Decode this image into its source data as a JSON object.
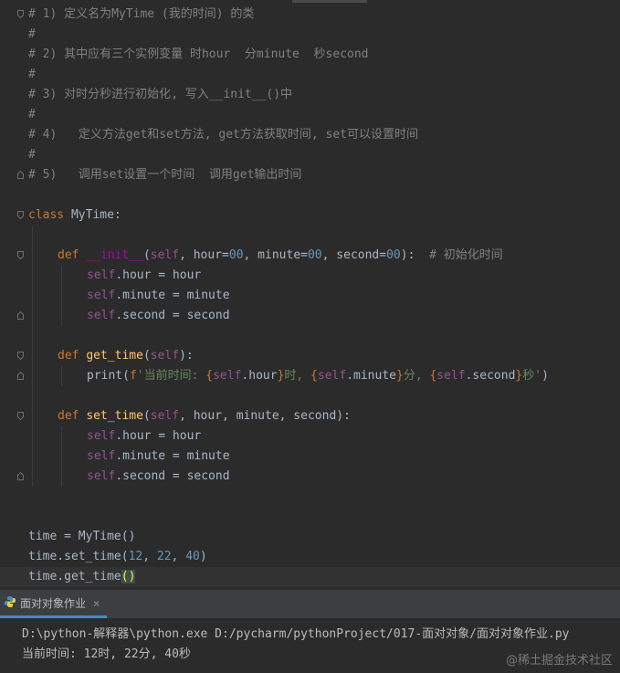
{
  "editor": {
    "lines": [
      {
        "indent": 0,
        "fold": "start",
        "tokens": [
          [
            "c-comment",
            "# 1) 定义名为MyTime (我的时间) 的类"
          ]
        ]
      },
      {
        "indent": 0,
        "tokens": [
          [
            "c-comment",
            "#"
          ]
        ]
      },
      {
        "indent": 0,
        "tokens": [
          [
            "c-comment",
            "# 2) 其中应有三个实例变量 时hour  分minute  秒second"
          ]
        ]
      },
      {
        "indent": 0,
        "tokens": [
          [
            "c-comment",
            "#"
          ]
        ]
      },
      {
        "indent": 0,
        "tokens": [
          [
            "c-comment",
            "# 3) 对时分秒进行初始化, 写入__init__()中"
          ]
        ]
      },
      {
        "indent": 0,
        "tokens": [
          [
            "c-comment",
            "#"
          ]
        ]
      },
      {
        "indent": 0,
        "tokens": [
          [
            "c-comment",
            "# 4)   定义方法get和set方法, get方法获取时间, set可以设置时间"
          ]
        ]
      },
      {
        "indent": 0,
        "tokens": [
          [
            "c-comment",
            "#"
          ]
        ]
      },
      {
        "indent": 0,
        "fold": "end",
        "tokens": [
          [
            "c-comment",
            "# 5)   调用set设置一个时间  调用get输出时间"
          ]
        ]
      },
      {
        "indent": 0,
        "tokens": []
      },
      {
        "indent": 0,
        "fold": "start",
        "tokens": [
          [
            "c-kw",
            "class "
          ],
          [
            "c-plain",
            "MyTime:"
          ]
        ]
      },
      {
        "indent": 0,
        "tokens": []
      },
      {
        "indent": 1,
        "fold": "start",
        "tokens": [
          [
            "c-kw",
            "def "
          ],
          [
            "c-magic",
            "__init__"
          ],
          [
            "c-plain",
            "("
          ],
          [
            "c-self",
            "self"
          ],
          [
            "c-plain",
            ", hour="
          ],
          [
            "c-num",
            "00"
          ],
          [
            "c-plain",
            ", minute="
          ],
          [
            "c-num",
            "00"
          ],
          [
            "c-plain",
            ", second="
          ],
          [
            "c-num",
            "00"
          ],
          [
            "c-plain",
            "):  "
          ],
          [
            "c-comment",
            "# 初始化时间"
          ]
        ]
      },
      {
        "indent": 2,
        "tokens": [
          [
            "c-self",
            "self"
          ],
          [
            "c-plain",
            ".hour = hour"
          ]
        ]
      },
      {
        "indent": 2,
        "tokens": [
          [
            "c-self",
            "self"
          ],
          [
            "c-plain",
            ".minute = minute"
          ]
        ]
      },
      {
        "indent": 2,
        "fold": "end",
        "tokens": [
          [
            "c-self",
            "self"
          ],
          [
            "c-plain",
            ".second = second"
          ]
        ]
      },
      {
        "indent": 0,
        "tokens": []
      },
      {
        "indent": 1,
        "fold": "start",
        "tokens": [
          [
            "c-kw",
            "def "
          ],
          [
            "c-fn",
            "get_time"
          ],
          [
            "c-plain",
            "("
          ],
          [
            "c-self",
            "self"
          ],
          [
            "c-plain",
            "):"
          ]
        ]
      },
      {
        "indent": 2,
        "fold": "end",
        "tokens": [
          [
            "c-plain",
            "print("
          ],
          [
            "c-kw",
            "f"
          ],
          [
            "c-str",
            "'当前时间: "
          ],
          [
            "c-brace",
            "{"
          ],
          [
            "c-self",
            "self"
          ],
          [
            "c-plain",
            ".hour"
          ],
          [
            "c-brace",
            "}"
          ],
          [
            "c-str",
            "时, "
          ],
          [
            "c-brace",
            "{"
          ],
          [
            "c-self",
            "self"
          ],
          [
            "c-plain",
            ".minute"
          ],
          [
            "c-brace",
            "}"
          ],
          [
            "c-str",
            "分, "
          ],
          [
            "c-brace",
            "{"
          ],
          [
            "c-self",
            "self"
          ],
          [
            "c-plain",
            ".second"
          ],
          [
            "c-brace",
            "}"
          ],
          [
            "c-str",
            "秒'"
          ],
          [
            "c-plain",
            ")"
          ]
        ]
      },
      {
        "indent": 0,
        "tokens": []
      },
      {
        "indent": 1,
        "fold": "start",
        "tokens": [
          [
            "c-kw",
            "def "
          ],
          [
            "c-fn",
            "set_time"
          ],
          [
            "c-plain",
            "("
          ],
          [
            "c-self",
            "self"
          ],
          [
            "c-plain",
            ", hour, minute, second):"
          ]
        ]
      },
      {
        "indent": 2,
        "tokens": [
          [
            "c-self",
            "self"
          ],
          [
            "c-plain",
            ".hour = hour"
          ]
        ]
      },
      {
        "indent": 2,
        "tokens": [
          [
            "c-self",
            "self"
          ],
          [
            "c-plain",
            ".minute = minute"
          ]
        ]
      },
      {
        "indent": 2,
        "fold": "end",
        "tokens": [
          [
            "c-self",
            "self"
          ],
          [
            "c-plain",
            ".second = second"
          ]
        ]
      },
      {
        "indent": 0,
        "tokens": []
      },
      {
        "indent": 0,
        "tokens": []
      },
      {
        "indent": 0,
        "tokens": [
          [
            "c-plain",
            "time = MyTime()"
          ]
        ]
      },
      {
        "indent": 0,
        "tokens": [
          [
            "c-plain",
            "time.set_time("
          ],
          [
            "c-num",
            "12"
          ],
          [
            "c-plain",
            ", "
          ],
          [
            "c-num",
            "22"
          ],
          [
            "c-plain",
            ", "
          ],
          [
            "c-num",
            "40"
          ],
          [
            "c-plain",
            ")"
          ]
        ]
      },
      {
        "indent": 0,
        "current": true,
        "tokens": [
          [
            "c-plain",
            "time.get_time"
          ],
          [
            "c-paren-hl",
            "()"
          ]
        ]
      }
    ]
  },
  "run_panel": {
    "tab_label": "面对对象作业",
    "tab_icon": "python-icon",
    "close_glyph": "×",
    "output": [
      "D:\\python-解释器\\python.exe D:/pycharm/pythonProject/017-面对对象/面对对象作业.py",
      "当前时间: 12时, 22分, 40秒"
    ]
  },
  "watermark": "@稀土掘金技术社区",
  "colors": {
    "background": "#2b2b2b",
    "comment": "#808080",
    "keyword": "#cc7832",
    "function": "#ffc66d",
    "self": "#94558d",
    "number": "#6897bb",
    "string": "#6a8759",
    "text": "#a9b7c6",
    "tab_accent": "#4a88c7"
  }
}
